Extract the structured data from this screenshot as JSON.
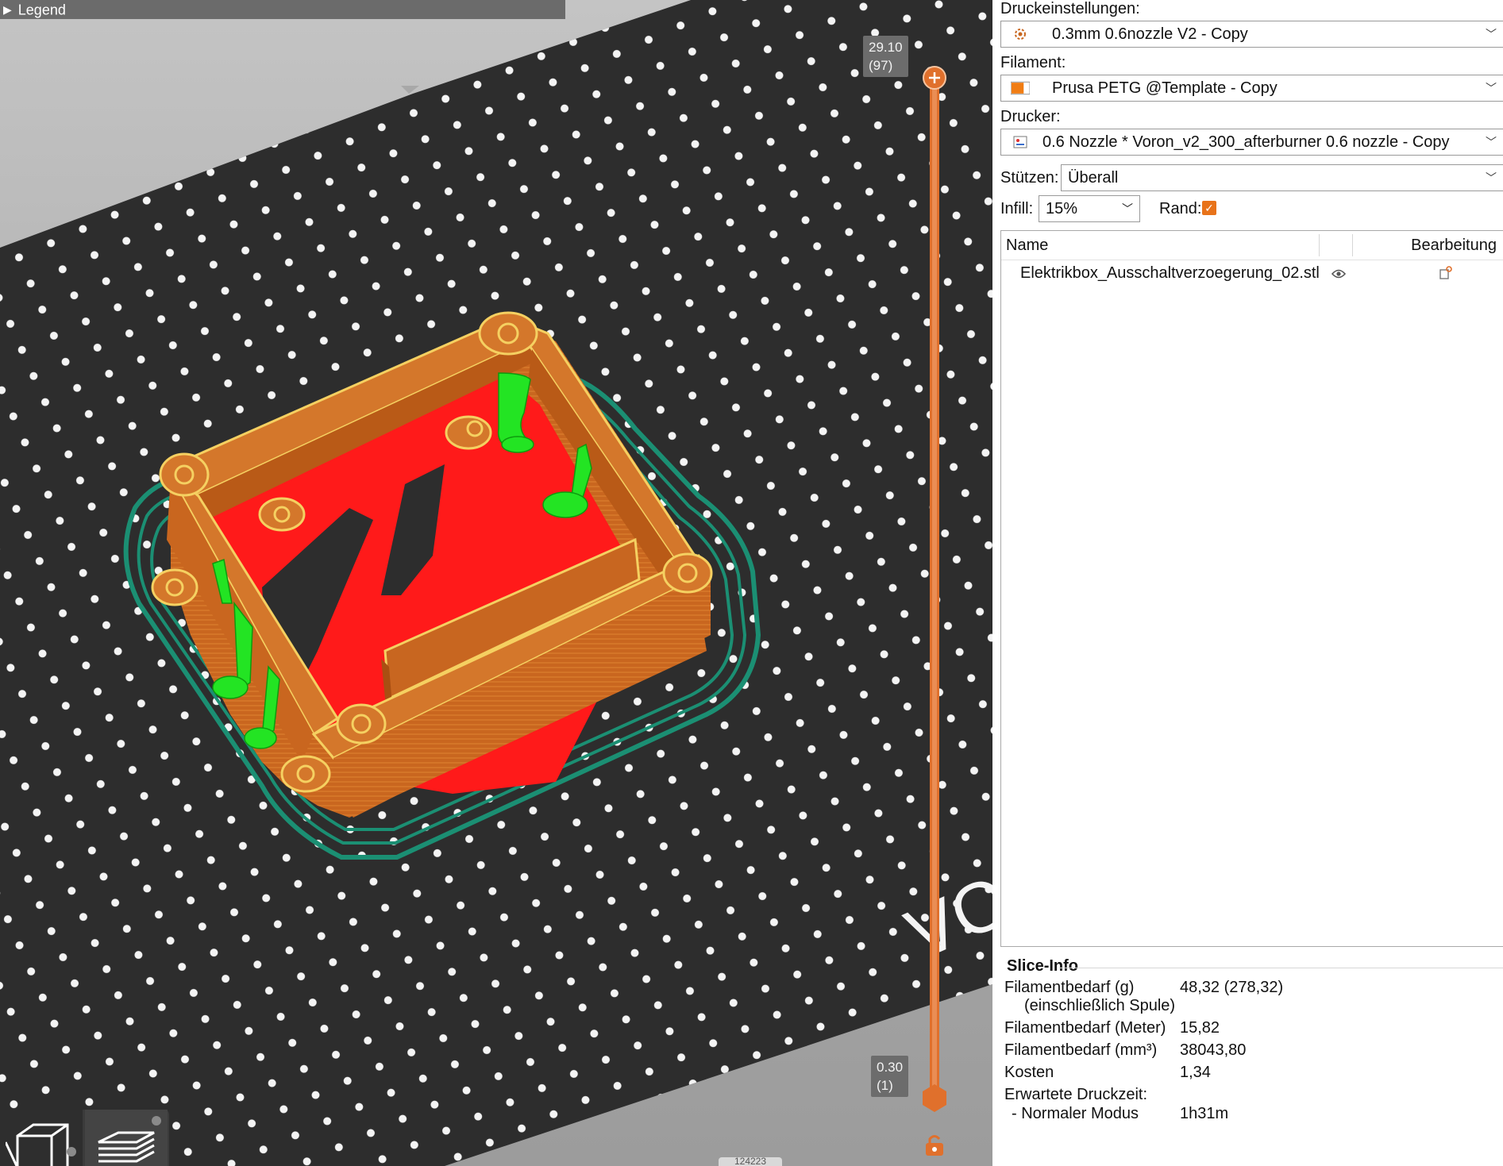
{
  "viewport": {
    "legend_label": "Legend",
    "layer_top": {
      "height": "29.10",
      "layer": "(97)"
    },
    "layer_bottom": {
      "height": "0.30",
      "layer": "(1)"
    },
    "bed_logo_text": "VO",
    "coord_text": "124223",
    "icons": [
      "expand-triangle-icon",
      "slider-plus-icon",
      "lock-icon",
      "iso-view-icon",
      "layers-view-icon"
    ],
    "colors": {
      "bed": "#2d2d2d",
      "bed_dots": "#f4f4f4",
      "wall": "#c8661e",
      "wall_highlight": "#e79a45",
      "perimeter": "#f5d061",
      "first_layer": "#ff1a1a",
      "support": "#23e423",
      "skirt": "#1b8f73",
      "slider": "#e0702c"
    }
  },
  "sidebar": {
    "print_settings_label": "Druckeinstellungen:",
    "print_settings_value": "0.3mm 0.6nozzle V2 - Copy",
    "filament_label": "Filament:",
    "filament_value": "Prusa PETG @Template - Copy",
    "filament_color": "#f07d14",
    "printer_label": "Drucker:",
    "printer_value": "0.6 Nozzle * Voron_v2_300_afterburner 0.6 nozzle - Copy",
    "supports_label": "Stützen:",
    "supports_value": "Überall",
    "infill_label": "Infill:",
    "infill_value": "15%",
    "brim_label": "Rand:",
    "brim_checked": true,
    "objects": {
      "col_name": "Name",
      "col_edit": "Bearbeitung",
      "rows": [
        {
          "name": "Elektrikbox_Ausschaltverzoegerung_02.stl"
        }
      ]
    },
    "slice_info": {
      "title": "Slice-Info",
      "rows": [
        {
          "label": "Filamentbedarf (g)",
          "label2": "(einschließlich Spule)",
          "value": "48,32 (278,32)"
        },
        {
          "label": "Filamentbedarf (Meter)",
          "value": "15,82"
        },
        {
          "label": "Filamentbedarf (mm³)",
          "value": "38043,80"
        },
        {
          "label": "Kosten",
          "value": "1,34"
        },
        {
          "label": "Erwartete Druckzeit:",
          "value": ""
        },
        {
          "label": "- Normaler Modus",
          "value": "1h31m"
        }
      ]
    }
  }
}
